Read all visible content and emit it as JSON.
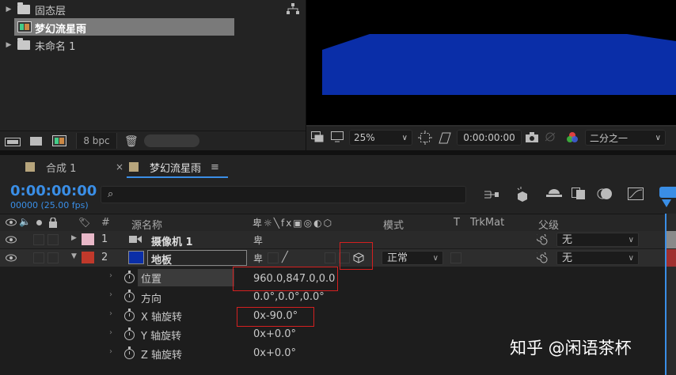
{
  "project": {
    "items": [
      {
        "label": "固态层",
        "type": "folder",
        "expanded": false
      },
      {
        "label": "梦幻流星雨",
        "type": "comp",
        "selected": true
      },
      {
        "label": "未命名 1",
        "type": "folder",
        "expanded": false
      }
    ],
    "footer": {
      "bpc": "8 bpc"
    }
  },
  "viewer": {
    "zoom": "25%",
    "timecode": "0:00:00:00",
    "resolution": "二分之一"
  },
  "timeline": {
    "tabs": [
      {
        "label": "合成 1"
      },
      {
        "label": "梦幻流星雨",
        "active": true
      }
    ],
    "current_time": "0:00:00:00",
    "frame_info": "00000 (25.00 fps)",
    "search_placeholder": "",
    "columns": {
      "num": "#",
      "source_name": "源名称",
      "mode": "模式",
      "t": "T",
      "trkmat": "TrkMat",
      "parent": "父级"
    },
    "layers": [
      {
        "num": "1",
        "name": "摄像机 1",
        "label_color": "#e8b8c8",
        "parent": "无",
        "switch": "卑"
      },
      {
        "num": "2",
        "name": "地板",
        "label_color": "#c0392b",
        "parent": "无",
        "mode": "正常",
        "switch": "卑"
      }
    ],
    "properties": [
      {
        "name": "位置",
        "value": "960.0,847.0,0.0"
      },
      {
        "name": "方向",
        "value": "0.0°,0.0°,0.0°"
      },
      {
        "name": "X 轴旋转",
        "value": "0x-90.0°"
      },
      {
        "name": "Y 轴旋转",
        "value": "0x+0.0°"
      },
      {
        "name": "Z 轴旋转",
        "value": "0x+0.0°"
      }
    ]
  },
  "watermark": "知乎 @闲语茶杯",
  "colors": {
    "accent_blue": "#3a8ee6",
    "floor_blue": "#0a2ea8",
    "highlight_red": "#d42020"
  }
}
